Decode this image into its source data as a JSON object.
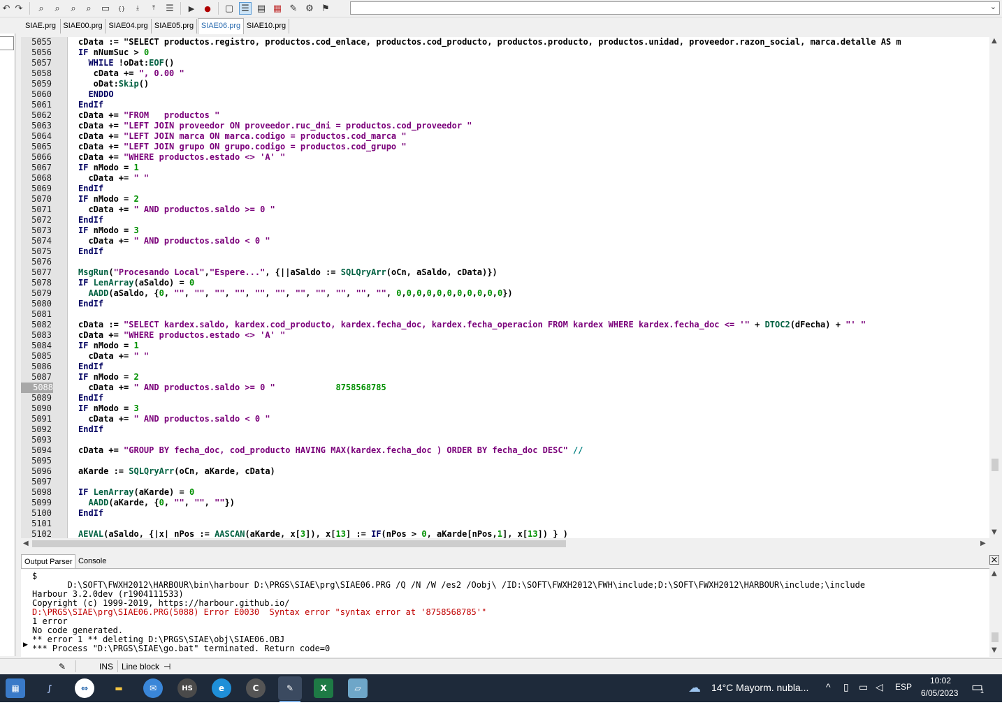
{
  "toolbar": {
    "buttons": [
      "undo-icon",
      "redo-icon",
      "find-icon",
      "find-next-icon",
      "find-prev-icon",
      "replace-icon",
      "open-folder-icon",
      "main-brace-icon",
      "main-down-icon",
      "main-up-icon",
      "list-icon",
      "run-icon",
      "record-icon",
      "window-icon",
      "outline-icon",
      "page-icon",
      "palette-icon",
      "pen-icon",
      "tools-icon",
      "exit-runner-icon"
    ],
    "combo_value": ""
  },
  "tabs": [
    {
      "label": "SIAE.prg",
      "active": false
    },
    {
      "label": "SIAE00.prg",
      "active": false
    },
    {
      "label": "SIAE04.prg",
      "active": false
    },
    {
      "label": "SIAE05.prg",
      "active": false
    },
    {
      "label": "SIAE06.prg",
      "active": true
    },
    {
      "label": "SIAE10.prg",
      "active": false
    }
  ],
  "editor": {
    "current_line": "5088",
    "lines": [
      {
        "n": "5055",
        "t": "cData := \"SELECT productos.registro, productos.cod_enlace, productos.cod_producto, productos.producto, productos.unidad, proveedor.razon_social, marca.detalle AS m"
      },
      {
        "n": "5056",
        "t": "IF nNumSuc > 0"
      },
      {
        "n": "5057",
        "t": "  WHILE !oDat:EOF()"
      },
      {
        "n": "5058",
        "t": "   cData += \", 0.00 \""
      },
      {
        "n": "5059",
        "t": "   oDat:Skip()"
      },
      {
        "n": "5060",
        "t": "  ENDDO"
      },
      {
        "n": "5061",
        "t": "EndIf"
      },
      {
        "n": "5062",
        "t": "cData += \"FROM   productos \""
      },
      {
        "n": "5063",
        "t": "cData += \"LEFT JOIN proveedor ON proveedor.ruc_dni = productos.cod_proveedor \""
      },
      {
        "n": "5064",
        "t": "cData += \"LEFT JOIN marca ON marca.codigo = productos.cod_marca \""
      },
      {
        "n": "5065",
        "t": "cData += \"LEFT JOIN grupo ON grupo.codigo = productos.cod_grupo \""
      },
      {
        "n": "5066",
        "t": "cData += \"WHERE productos.estado <> 'A' \""
      },
      {
        "n": "5067",
        "t": "IF nModo = 1"
      },
      {
        "n": "5068",
        "t": "  cData += \" \""
      },
      {
        "n": "5069",
        "t": "EndIf"
      },
      {
        "n": "5070",
        "t": "IF nModo = 2"
      },
      {
        "n": "5071",
        "t": "  cData += \" AND productos.saldo >= 0 \""
      },
      {
        "n": "5072",
        "t": "EndIf"
      },
      {
        "n": "5073",
        "t": "IF nModo = 3"
      },
      {
        "n": "5074",
        "t": "  cData += \" AND productos.saldo < 0 \""
      },
      {
        "n": "5075",
        "t": "EndIf"
      },
      {
        "n": "5076",
        "t": ""
      },
      {
        "n": "5077",
        "t": "MsgRun(\"Procesando Local\",\"Espere...\", {||aSaldo := SQLQryArr(oCn, aSaldo, cData)})"
      },
      {
        "n": "5078",
        "t": "IF LenArray(aSaldo) = 0"
      },
      {
        "n": "5079",
        "t": "  AADD(aSaldo, {0, \"\", \"\", \"\", \"\", \"\", \"\", \"\", \"\", \"\", \"\", \"\", 0,0,0,0,0,0,0,0,0,0,0})"
      },
      {
        "n": "5080",
        "t": "EndIf"
      },
      {
        "n": "5081",
        "t": ""
      },
      {
        "n": "5082",
        "t": "cData := \"SELECT kardex.saldo, kardex.cod_producto, kardex.fecha_doc, kardex.fecha_operacion FROM kardex WHERE kardex.fecha_doc <= '\" + DTOC2(dFecha) + \"' \""
      },
      {
        "n": "5083",
        "t": "cData += \"WHERE productos.estado <> 'A' \""
      },
      {
        "n": "5084",
        "t": "IF nModo = 1"
      },
      {
        "n": "5085",
        "t": "  cData += \" \""
      },
      {
        "n": "5086",
        "t": "EndIf"
      },
      {
        "n": "5087",
        "t": "IF nModo = 2"
      },
      {
        "n": "5088",
        "t": "  cData += \" AND productos.saldo >= 0 \"            8758568785"
      },
      {
        "n": "5089",
        "t": "EndIf"
      },
      {
        "n": "5090",
        "t": "IF nModo = 3"
      },
      {
        "n": "5091",
        "t": "  cData += \" AND productos.saldo < 0 \""
      },
      {
        "n": "5092",
        "t": "EndIf"
      },
      {
        "n": "5093",
        "t": ""
      },
      {
        "n": "5094",
        "t": "cData += \"GROUP BY fecha_doc, cod_producto HAVING MAX(kardex.fecha_doc ) ORDER BY fecha_doc DESC\" //"
      },
      {
        "n": "5095",
        "t": ""
      },
      {
        "n": "5096",
        "t": "aKarde := SQLQryArr(oCn, aKarde, cData)"
      },
      {
        "n": "5097",
        "t": ""
      },
      {
        "n": "5098",
        "t": "IF LenArray(aKarde) = 0"
      },
      {
        "n": "5099",
        "t": "  AADD(aKarde, {0, \"\", \"\", \"\"})"
      },
      {
        "n": "5100",
        "t": "EndIf"
      },
      {
        "n": "5101",
        "t": ""
      },
      {
        "n": "5102",
        "t": "AEVAL(aSaldo, {|x| nPos := AASCAN(aKarde, x[3]), x[13] := IF(nPos > 0, aKarde[nPos,1], x[13]) } )"
      }
    ]
  },
  "output_tabs": [
    {
      "label": "Output Parser",
      "active": true
    },
    {
      "label": "Console",
      "active": false
    }
  ],
  "output": {
    "lines": [
      {
        "t": "$",
        "err": false
      },
      {
        "t": "       D:\\SOFT\\FWXH2012\\HARBOUR\\bin\\harbour D:\\PRGS\\SIAE\\prg\\SIAE06.PRG /Q /N /W /es2 /Oobj\\ /ID:\\SOFT\\FWXH2012\\FWH\\include;D:\\SOFT\\FWXH2012\\HARBOUR\\include;\\include",
        "err": false
      },
      {
        "t": "Harbour 3.2.0dev (r1904111533)",
        "err": false
      },
      {
        "t": "Copyright (c) 1999-2019, https://harbour.github.io/",
        "err": false
      },
      {
        "t": "D:\\PRGS\\SIAE\\prg\\SIAE06.PRG(5088) Error E0030  Syntax error \"syntax error at '8758568785'\"",
        "err": true
      },
      {
        "t": "1 error",
        "err": false
      },
      {
        "t": "No code generated.",
        "err": false
      },
      {
        "t": "** error 1 ** deleting D:\\PRGS\\SIAE\\obj\\SIAE06.OBJ",
        "err": false
      },
      {
        "t": "*** Process \"D:\\PRGS\\SIAE\\go.bat\" terminated. Return code=0",
        "err": false
      }
    ]
  },
  "statusbar": {
    "ins": "INS",
    "mode": "Line block"
  },
  "taskbar": {
    "apps": [
      "calculator-icon",
      "dolphin-icon",
      "teamviewer-icon",
      "file-explorer-icon",
      "chat-icon",
      "hs-icon",
      "edge-icon",
      "ccleaner-icon",
      "ide-icon",
      "excel-icon",
      "notes-icon"
    ],
    "weather": "14°C  Mayorm. nubla...",
    "lang": "ESP",
    "time": "10:02",
    "date": "6/05/2023",
    "notif_count": "1"
  },
  "colors": {
    "keyword": "#000060",
    "string": "#7a007a",
    "number": "#009000",
    "function": "#006040",
    "error_text": "#c00000",
    "taskbar_bg": "#1e2a3a",
    "active_tab_text": "#2b6cb0"
  }
}
